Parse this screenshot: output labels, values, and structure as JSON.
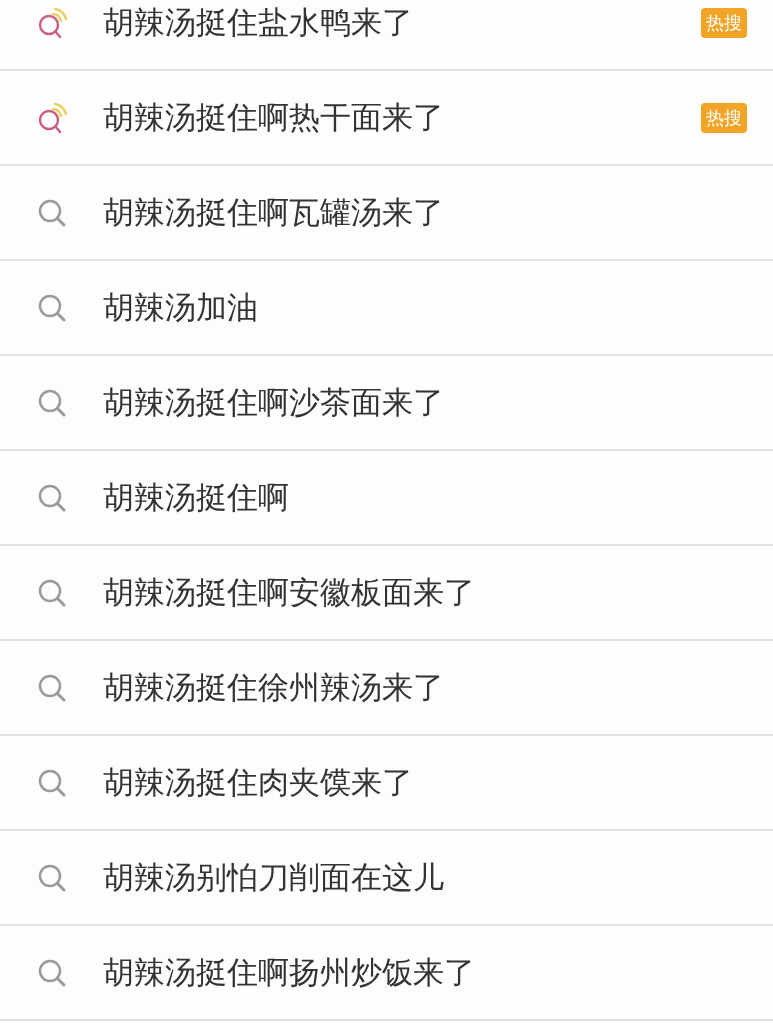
{
  "suggestions": [
    {
      "kind": "hot",
      "text": "胡辣汤挺住盐水鸭来了",
      "badge": "热搜"
    },
    {
      "kind": "hot",
      "text": "胡辣汤挺住啊热干面来了",
      "badge": "热搜"
    },
    {
      "kind": "normal",
      "text": "胡辣汤挺住啊瓦罐汤来了"
    },
    {
      "kind": "normal",
      "text": "胡辣汤加油"
    },
    {
      "kind": "normal",
      "text": "胡辣汤挺住啊沙茶面来了"
    },
    {
      "kind": "normal",
      "text": "胡辣汤挺住啊"
    },
    {
      "kind": "normal",
      "text": "胡辣汤挺住啊安徽板面来了"
    },
    {
      "kind": "normal",
      "text": "胡辣汤挺住徐州辣汤来了"
    },
    {
      "kind": "normal",
      "text": "胡辣汤挺住肉夹馍来了"
    },
    {
      "kind": "normal",
      "text": "胡辣汤别怕刀削面在这儿"
    },
    {
      "kind": "normal",
      "text": "胡辣汤挺住啊扬州炒饭来了"
    }
  ]
}
